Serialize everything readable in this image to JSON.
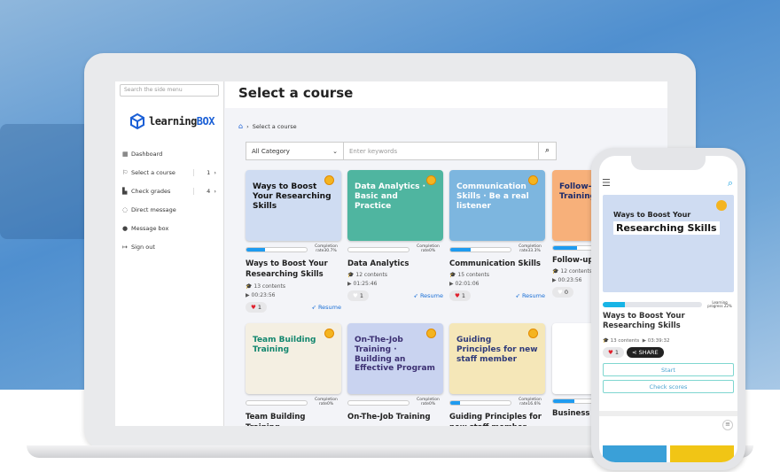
{
  "colors": {
    "accent": "#1a6fd6",
    "progress": "#1e9bf0",
    "like": "#e0202c"
  },
  "sidebar": {
    "search_placeholder": "Search the side menu",
    "logo_text": "learning",
    "logo_bold": "BOX",
    "items": [
      {
        "label": "Dashboard",
        "icon": "dashboard-icon"
      },
      {
        "label": "Select a course",
        "count": "1",
        "icon": "flag-icon"
      },
      {
        "label": "Check grades",
        "count": "4",
        "icon": "chart-icon"
      },
      {
        "label": "Direct message",
        "icon": "chat-icon"
      },
      {
        "label": "Message box",
        "icon": "messages-icon"
      },
      {
        "label": "Sign out",
        "icon": "signout-icon"
      }
    ]
  },
  "header": {
    "title": "Select a course"
  },
  "breadcrumb": {
    "current": "Select a course"
  },
  "filter": {
    "category": "All Category",
    "keyword_placeholder": "Enter keywords"
  },
  "courses": [
    {
      "thumb": "Ways to Boost Your Researching Skills",
      "bg": "#cfdcf2",
      "fg": "#111",
      "progress": 30.7,
      "rate": "Completion rate30.7%",
      "title": "Ways to Boost Your Researching Skills",
      "contents": "13 contents",
      "duration": "00:23:56",
      "likes": "1",
      "liked": true,
      "action": "Resume"
    },
    {
      "thumb": "Data Analytics · Basic and Practice",
      "bg": "#4fb5a0",
      "fg": "#fff",
      "progress": 0,
      "rate": "Completion rate0%",
      "title": "Data Analytics",
      "contents": "12 contents",
      "duration": "01:25:46",
      "likes": "1",
      "liked": false,
      "action": "Resume"
    },
    {
      "thumb": "Communication Skills · Be a real listener",
      "bg": "#7db6df",
      "fg": "#fff",
      "progress": 33.3,
      "rate": "Completion rate33.3%",
      "title": "Communication Skills",
      "contents": "15 contents",
      "duration": "02:01:06",
      "likes": "1",
      "liked": true,
      "action": "Resume"
    },
    {
      "thumb": "Follow-up Training",
      "bg": "#f7b07a",
      "fg": "#1b2a6b",
      "progress": 40,
      "rate": "",
      "title": "Follow-up",
      "contents": "12 contents",
      "duration": "00:23:56",
      "likes": "0",
      "liked": false,
      "action": ""
    },
    {
      "thumb": "Team Building Training",
      "bg": "#f4efe2",
      "fg": "#12866e",
      "progress": 0,
      "rate": "Completion rate0%",
      "title": "Team Building Training"
    },
    {
      "thumb": "On-The-Job Training · Building an Effective Program",
      "bg": "#c9d3f0",
      "fg": "#3b2f72",
      "progress": 0,
      "rate": "Completion rate0%",
      "title": "On-The-Job Training"
    },
    {
      "thumb": "Guiding Principles for new staff member",
      "bg": "#f5e7b8",
      "fg": "#2e3a7a",
      "progress": 16.6,
      "rate": "Completion rate16.6%",
      "title": "Guiding Principles for new staff member"
    },
    {
      "thumb": "",
      "bg": "#ffffff",
      "fg": "#222",
      "progress": 35,
      "rate": "",
      "title": "Business"
    }
  ],
  "phone": {
    "thumb_line1": "Ways to Boost Your",
    "thumb_line2": "Researching Skills",
    "progress": 22,
    "progress_label": "Learning progress 22%",
    "title": "Ways to Boost Your Researching Skills",
    "contents": "13 contents",
    "duration": "03:39:32",
    "likes": "1",
    "share": "SHARE",
    "start": "Start",
    "check_scores": "Check scores"
  }
}
